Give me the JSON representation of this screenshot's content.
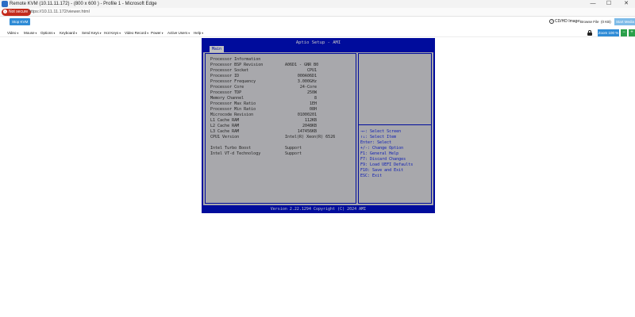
{
  "browser": {
    "window_title": "Remote KVM (10.11.11.172) - (800 x 600 ) - Profile 1 - Microsoft Edge",
    "controls": {
      "minimize": "—",
      "maximize": "☐",
      "close": "✕"
    },
    "not_secure_label": "Not secure",
    "url": "https://10.11.11.172/viewer.html"
  },
  "kvm_toolbar": {
    "stop_kvm": "Stop KVM",
    "cd_image_label": "CD/HD Image:",
    "browse_file": "Browse File",
    "file_size": "(0 KB)",
    "start_media": "Start Media"
  },
  "menu": {
    "items": [
      "Video",
      "Mouse",
      "Options",
      "Keyboard",
      "Send Keys",
      "Hot Keys",
      "Video Record",
      "Power",
      "Active Users",
      "Help"
    ],
    "caret": "▾",
    "zoom": "Zoom 100 %",
    "btn_minus": "−",
    "btn_plus": "+"
  },
  "bios": {
    "title": "Aptio Setup - AMI",
    "tab": "Main",
    "rows": [
      {
        "key": "Processor Information",
        "value": ""
      },
      {
        "key": "Processor BSP Revision",
        "value": "A06D1 - GNR B0"
      },
      {
        "key": "Processor Socket",
        "value": "CPU1"
      },
      {
        "key": "Processor ID",
        "value": "000A06D1"
      },
      {
        "key": "Processor Frequency",
        "value": "3.000GHz"
      },
      {
        "key": "Processor Core",
        "value": "24-Core"
      },
      {
        "key": "Processor TDP",
        "value": "250W"
      },
      {
        "key": "Memory Channel",
        "value": "8"
      },
      {
        "key": "Processor Max Ratio",
        "value": "1EH"
      },
      {
        "key": "Processor Min Ratio",
        "value": "08H"
      },
      {
        "key": "Microcode Revision",
        "value": "01000201"
      },
      {
        "key": "L1 Cache RAM",
        "value": "112KB"
      },
      {
        "key": "L2 Cache RAM",
        "value": "2048KB"
      },
      {
        "key": "L3 Cache RAM",
        "value": "147456KB"
      },
      {
        "key": "CPU1 Version",
        "value": "Intel(R) Xeon(R) 6526"
      },
      {
        "key": "",
        "value": ""
      },
      {
        "key": "Intel Turbo Boost",
        "value": "Support"
      },
      {
        "key": "Intel VT-d Technology",
        "value": "Support"
      }
    ],
    "help": [
      "→←: Select Screen",
      "↑↓: Select Item",
      "Enter: Select",
      "+/-: Change Option",
      "F1: General Help",
      "F7: Discard Changes",
      "F9: Load UEFI Defaults",
      "F10: Save and Exit",
      "ESC: Exit"
    ],
    "footer": "Version 2.22.1294 Copyright (C) 2024 AMI"
  }
}
